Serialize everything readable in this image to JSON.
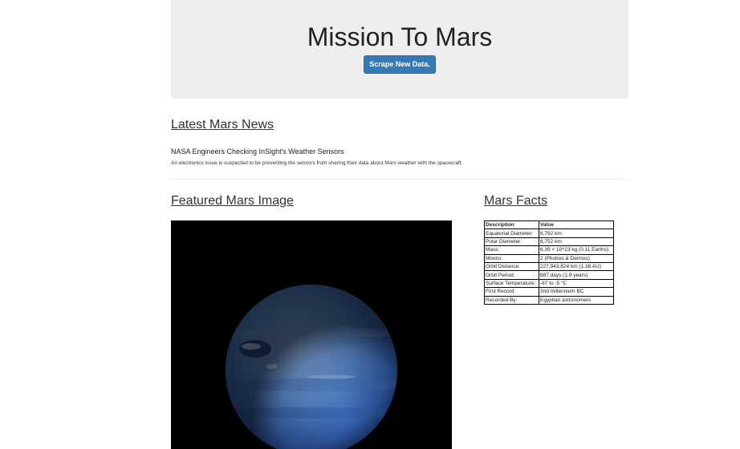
{
  "header": {
    "title": "Mission To Mars",
    "scrape_button_label": "Scrape New Data."
  },
  "news": {
    "section_title": "Latest Mars News",
    "headline": "NASA Engineers Checking InSight's Weather Sensors",
    "teaser": "An electronics issue is suspected to be preventing the sensors from sharing their data about Mars weather with the spacecraft."
  },
  "featured_image": {
    "section_title": "Featured Mars Image",
    "subject": "blue-planet-image"
  },
  "facts": {
    "section_title": "Mars Facts",
    "headers": [
      "Description",
      "Value"
    ],
    "rows": [
      {
        "description": "Equatorial Diameter:",
        "value": "6,792 km"
      },
      {
        "description": "Polar Diameter:",
        "value": "6,752 km"
      },
      {
        "description": "Mass:",
        "value": "6.39 × 10^23 kg (0.11 Earths)"
      },
      {
        "description": "Moons:",
        "value": "2 (Phobos & Deimos)"
      },
      {
        "description": "Orbit Distance:",
        "value": "227,943,824 km (1.38 AU)"
      },
      {
        "description": "Orbit Period:",
        "value": "687 days (1.9 years)"
      },
      {
        "description": "Surface Temperature:",
        "value": "-87 to -5 °C"
      },
      {
        "description": "First Record:",
        "value": "2nd millennium BC"
      },
      {
        "description": "Recorded By:",
        "value": "Egyptian astronomers"
      }
    ]
  },
  "colors": {
    "jumbotron_bg": "#eeeeee",
    "button_bg": "#337ab7",
    "image_bg": "#000000",
    "planet_blue": "#5b8fd6"
  }
}
